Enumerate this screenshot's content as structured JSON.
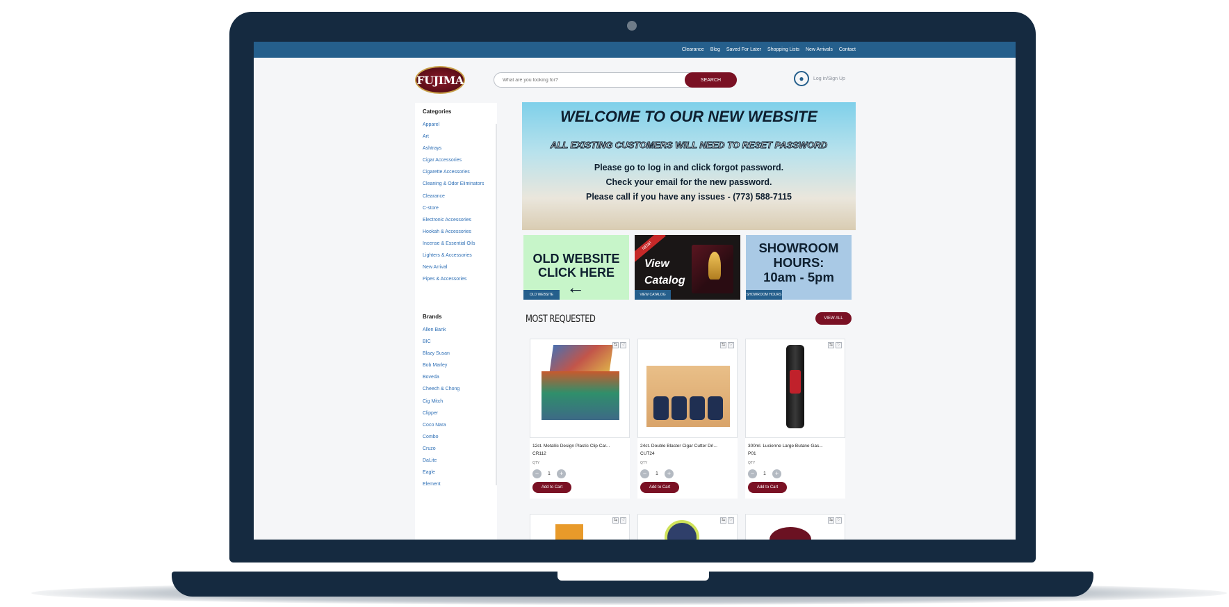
{
  "topnav": [
    "Clearance",
    "Blog",
    "Saved For Later",
    "Shopping Lists",
    "New Arrivals",
    "Contact"
  ],
  "logo_text": "FUJIMA",
  "search": {
    "placeholder": "What are you looking for?",
    "button": "SEARCH"
  },
  "account": {
    "label": "Log in/Sign Up"
  },
  "categories": {
    "title": "Categories",
    "items": [
      "Apparel",
      "Art",
      "Ashtrays",
      "Cigar Accessories",
      "Cigarette Accessories",
      "Cleaning & Odor Eliminators",
      "Clearance",
      "C-store",
      "Electronic Accessories",
      "Hookah & Accessories",
      "Incense & Essential Oils",
      "Lighters & Accessories",
      "New Arrival",
      "Pipes & Accessories"
    ]
  },
  "brands": {
    "title": "Brands",
    "items": [
      "Allen Bank",
      "BIC",
      "Blazy Susan",
      "Bob Marley",
      "Boveda",
      "Cheech & Chong",
      "Cig Mitch",
      "Clipper",
      "Coco Nara",
      "Combo",
      "Cruzo",
      "DaLite",
      "Eagle",
      "Element"
    ]
  },
  "hero": {
    "heading": "WELCOME TO OUR NEW WEBSITE",
    "subheading": "ALL EXISTING CUSTOMERS WILL NEED TO RESET PASSWORD",
    "line1": "Please go to log in and click forgot password.",
    "line2": "Check your email for the new password.",
    "line3": "Please call if you have any issues - (773) 588-7115"
  },
  "promos": [
    {
      "title_line1": "OLD WEBSITE",
      "title_line2": "CLICK HERE",
      "tag": "OLD WEBSITE"
    },
    {
      "ribbon": "NEW!",
      "title_line1": "View",
      "title_line2": "Catalog",
      "tag": "VIEW CATALOG"
    },
    {
      "title_line1": "SHOWROOM",
      "title_line2": "HOURS:",
      "title_line3": "10am - 5pm",
      "tag": "SHOWROOM HOURS"
    }
  ],
  "most_requested": {
    "title": "MOST REQUESTED",
    "view_all": "VIEW ALL"
  },
  "products": [
    {
      "name": "12ct. Metallic Design Plastic Clip Car...",
      "sku": "CR112",
      "qty_label": "QTY",
      "qty": "1",
      "add": "Add to Cart"
    },
    {
      "name": "24ct. Double Blaster Cigar Cutter Dri...",
      "sku": "CUT24",
      "qty_label": "QTY",
      "qty": "1",
      "add": "Add to Cart"
    },
    {
      "name": "300ml. Lucienne Large Butane Gas...",
      "sku": "P01",
      "qty_label": "QTY",
      "qty": "1",
      "add": "Add to Cart"
    }
  ],
  "colors": {
    "navy": "#152a40",
    "topbar": "#255f8c",
    "accent": "#7a1124",
    "link": "#2e6fb5"
  }
}
